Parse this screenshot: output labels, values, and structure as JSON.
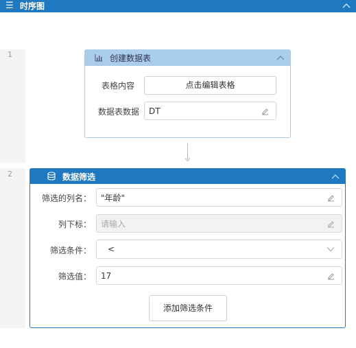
{
  "topbar": {
    "menu_icon": "☰",
    "title": "时序图"
  },
  "gutter": {
    "line1": "1",
    "line2": "2"
  },
  "node1": {
    "title": "创建数据表",
    "table_content_label": "表格内容",
    "edit_table_button": "点击编辑表格",
    "data_label": "数据表数据",
    "data_value": "DT"
  },
  "node2": {
    "title": "数据筛选",
    "column_name_label": "筛选的列名：",
    "column_name_value": "\"年龄\"",
    "column_index_label": "列下标：",
    "column_index_placeholder": "请输入",
    "condition_label": "筛选条件：",
    "condition_value": "<",
    "filter_value_label": "筛选值：",
    "filter_value": "17",
    "add_condition_button": "添加筛选条件"
  },
  "colors": {
    "primary": "#1f79c0",
    "light_header": "#a9cdea"
  }
}
